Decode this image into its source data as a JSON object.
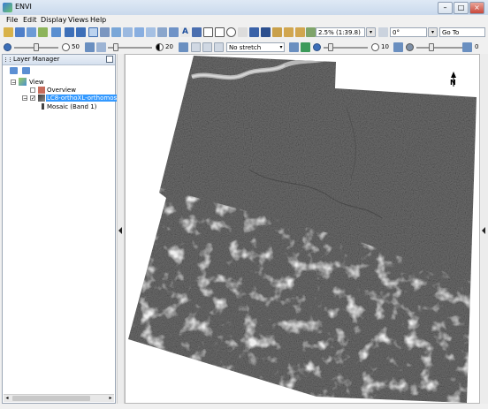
{
  "window": {
    "title": "ENVI"
  },
  "menu": [
    "File",
    "Edit",
    "Display",
    "Views",
    "Help"
  ],
  "toolbar": {
    "zoom_value": "2.5% (1:39.8)",
    "rotation_value": "0°",
    "goto_label": "Go To"
  },
  "toolbar2": {
    "brightness_value": "50",
    "contrast_value": "20",
    "stretch_value": "No stretch",
    "sharpen_value": "10",
    "transparency_value": "0"
  },
  "layer_manager": {
    "title": "Layer Manager",
    "tree": {
      "root": "View",
      "items": [
        {
          "label": "Overview",
          "checked": false
        },
        {
          "label": "LC8-orthoXL-orthomosaic",
          "checked": true,
          "selected": true
        },
        {
          "label": "Mosaic (Band 1)"
        }
      ]
    }
  },
  "view": {
    "north_arrow_label": "N"
  },
  "colors": {
    "title_gradient_top": "#dfe9f5",
    "selection": "#3399ff",
    "image_gray": "#6e6e6e"
  }
}
